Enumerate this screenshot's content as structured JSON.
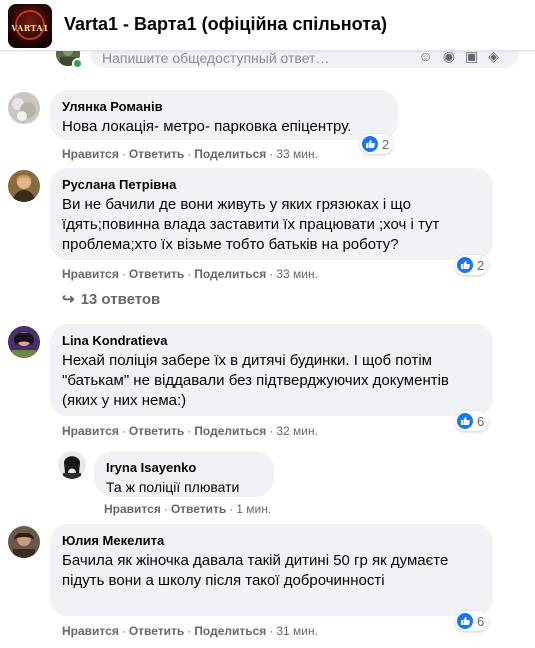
{
  "group": {
    "title": "Varta1 - Варта1 (офіційна спільнота)",
    "logo_text": "VARTA1"
  },
  "composer": {
    "placeholder": "Напишите общедоступный ответ…",
    "icons": [
      "emoji-icon",
      "camera-icon",
      "gif-icon",
      "sticker-icon"
    ]
  },
  "labels": {
    "like": "Нравится",
    "reply": "Ответить",
    "share": "Поделиться",
    "sep": "·"
  },
  "comments": [
    {
      "author": "Улянка Романів",
      "text": "Нова локація- метро- парковка епіцентру.",
      "time": "33 мин.",
      "reactions": "2"
    },
    {
      "author": "Руслана Петрівна",
      "text": "Ви не бачили де вони живуть у яких грязюках і що їдять;повинна влада заставити їх працювати ;хоч і тут проблема;хто їх візьме тобто батьків на роботу?",
      "time": "33 мин.",
      "reactions": "2"
    },
    {
      "author": "Lina Kondratieva",
      "text": "Нехай поліція забере їх в дитячі будинки. І щоб потім \"батькам\" не віддавали без підтверджуючих документів (яких у них нема:)",
      "time": "32 мин.",
      "reactions": "6"
    },
    {
      "author": "Юлия Мекелита",
      "text": "Бачила як жіночка давала такій дитині 50 гр як думаєте підуть вони а школу після такої доброчинності",
      "time": "31 мин.",
      "reactions": "6"
    }
  ],
  "replies_link": "13 ответов",
  "reply": {
    "author": "Iryna Isayenko",
    "text": "Та ж поліції плювати",
    "time": "1 мин."
  },
  "colors": {
    "accent": "#1877f2",
    "bubble": "#f0f2f5",
    "secondary_text": "#65676b"
  }
}
